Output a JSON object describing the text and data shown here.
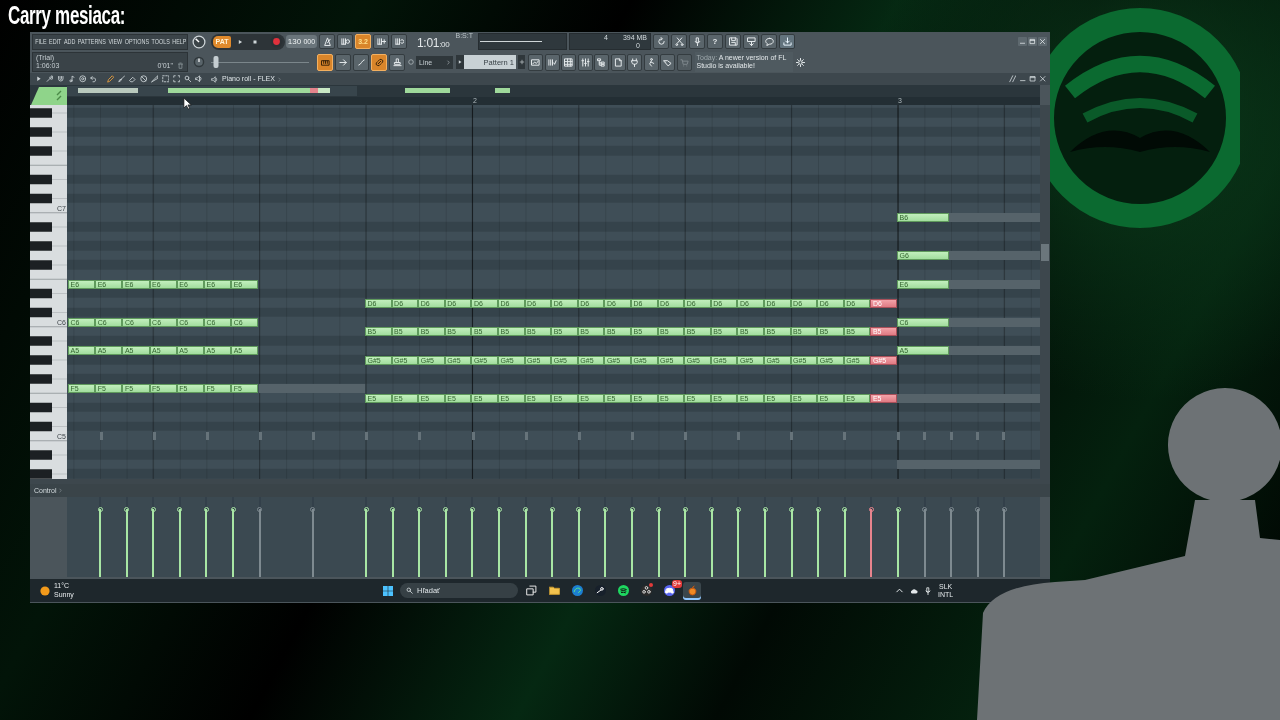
{
  "overlay": {
    "title": "Carry mesiaca:"
  },
  "menu": [
    "FILE",
    "EDIT",
    "ADD",
    "PATTERNS",
    "VIEW",
    "OPTIONS",
    "TOOLS",
    "HELP"
  ],
  "transport": {
    "mode": "PAT",
    "tempo": "130",
    "tempo_decimals": "000"
  },
  "top_toggles": [
    {
      "on": false
    },
    {
      "on": false
    },
    {
      "label": "3.2",
      "on": true
    },
    {
      "on": false
    },
    {
      "on": false
    }
  ],
  "song_position": {
    "value": "1:01",
    "ticks": ":00",
    "format": "B:S:T"
  },
  "cpu_panel": {
    "cpu": "4",
    "memory": "394 MB",
    "polyphony": "0"
  },
  "help_button": "?",
  "hint_panel": {
    "lines": [
      "(Trial)",
      "1:06:03"
    ],
    "value": "0'01\""
  },
  "pitch_slider": {
    "level": 0.05
  },
  "bottom_toggles": [
    {
      "on": true
    },
    {
      "on": false
    },
    {
      "on": false
    },
    {
      "on": true
    },
    {
      "on": false
    }
  ],
  "snap": "Line",
  "pattern": "Pattern 1",
  "news": {
    "date": "Today:",
    "text": "A newer version of FL Studio is available!"
  },
  "piano_roll": {
    "title": "Piano roll - FLEX",
    "tools": [
      {
        "selected": true
      },
      {
        "selected": false
      },
      {
        "selected": false
      },
      {
        "selected": false
      },
      {
        "selected": false
      },
      {
        "selected": false
      },
      {
        "selected": false
      },
      {
        "selected": false
      },
      {
        "selected": false
      }
    ],
    "keys": [
      "C7",
      "C6",
      "C5"
    ],
    "ruler": [
      "2",
      "3"
    ],
    "note_groups": [
      {
        "rows": [
          {
            "notes": [
              {
                "label": "E6",
                "selected": false
              },
              {
                "label": "E6",
                "selected": false
              },
              {
                "label": "E6",
                "selected": false
              },
              {
                "label": "E6",
                "selected": false
              },
              {
                "label": "E6",
                "selected": false
              },
              {
                "label": "E6",
                "selected": false
              },
              {
                "label": "E6",
                "selected": false
              }
            ]
          },
          {
            "notes": [
              {
                "label": "C6",
                "selected": false
              },
              {
                "label": "C6",
                "selected": false
              },
              {
                "label": "C6",
                "selected": false
              },
              {
                "label": "C6",
                "selected": false
              },
              {
                "label": "C6",
                "selected": false
              },
              {
                "label": "C6",
                "selected": false
              },
              {
                "label": "C6",
                "selected": false
              }
            ]
          },
          {
            "notes": [
              {
                "label": "A5",
                "selected": false
              },
              {
                "label": "A5",
                "selected": false
              },
              {
                "label": "A5",
                "selected": false
              },
              {
                "label": "A5",
                "selected": false
              },
              {
                "label": "A5",
                "selected": false
              },
              {
                "label": "A5",
                "selected": false
              },
              {
                "label": "A5",
                "selected": false
              }
            ]
          },
          {
            "notes": [
              {
                "label": "F5",
                "selected": false
              },
              {
                "label": "F5",
                "selected": false
              },
              {
                "label": "F5",
                "selected": false
              },
              {
                "label": "F5",
                "selected": false
              },
              {
                "label": "F5",
                "selected": false
              },
              {
                "label": "F5",
                "selected": false
              },
              {
                "label": "F5",
                "selected": false
              }
            ]
          }
        ]
      },
      {
        "rows": [
          {
            "notes": [
              {
                "label": "D6",
                "selected": false
              },
              {
                "label": "D6",
                "selected": false
              },
              {
                "label": "D6",
                "selected": false
              },
              {
                "label": "D6",
                "selected": false
              },
              {
                "label": "D6",
                "selected": false
              },
              {
                "label": "D6",
                "selected": false
              },
              {
                "label": "D6",
                "selected": false
              },
              {
                "label": "D6",
                "selected": false
              },
              {
                "label": "D6",
                "selected": false
              },
              {
                "label": "D6",
                "selected": false
              },
              {
                "label": "D6",
                "selected": false
              },
              {
                "label": "D6",
                "selected": false
              },
              {
                "label": "D6",
                "selected": false
              },
              {
                "label": "D6",
                "selected": false
              },
              {
                "label": "D6",
                "selected": false
              },
              {
                "label": "D6",
                "selected": false
              },
              {
                "label": "D6",
                "selected": false
              },
              {
                "label": "D6",
                "selected": false
              },
              {
                "label": "D6",
                "selected": false
              },
              {
                "label": "D6",
                "selected": true
              }
            ]
          },
          {
            "notes": [
              {
                "label": "B5",
                "selected": false
              },
              {
                "label": "B5",
                "selected": false
              },
              {
                "label": "B5",
                "selected": false
              },
              {
                "label": "B5",
                "selected": false
              },
              {
                "label": "B5",
                "selected": false
              },
              {
                "label": "B5",
                "selected": false
              },
              {
                "label": "B5",
                "selected": false
              },
              {
                "label": "B5",
                "selected": false
              },
              {
                "label": "B5",
                "selected": false
              },
              {
                "label": "B5",
                "selected": false
              },
              {
                "label": "B5",
                "selected": false
              },
              {
                "label": "B5",
                "selected": false
              },
              {
                "label": "B5",
                "selected": false
              },
              {
                "label": "B5",
                "selected": false
              },
              {
                "label": "B5",
                "selected": false
              },
              {
                "label": "B5",
                "selected": false
              },
              {
                "label": "B5",
                "selected": false
              },
              {
                "label": "B5",
                "selected": false
              },
              {
                "label": "B5",
                "selected": false
              },
              {
                "label": "B5",
                "selected": true
              }
            ]
          },
          {
            "notes": [
              {
                "label": "G#5",
                "selected": false
              },
              {
                "label": "G#5",
                "selected": false
              },
              {
                "label": "G#5",
                "selected": false
              },
              {
                "label": "G#5",
                "selected": false
              },
              {
                "label": "G#5",
                "selected": false
              },
              {
                "label": "G#5",
                "selected": false
              },
              {
                "label": "G#5",
                "selected": false
              },
              {
                "label": "G#5",
                "selected": false
              },
              {
                "label": "G#5",
                "selected": false
              },
              {
                "label": "G#5",
                "selected": false
              },
              {
                "label": "G#5",
                "selected": false
              },
              {
                "label": "G#5",
                "selected": false
              },
              {
                "label": "G#5",
                "selected": false
              },
              {
                "label": "G#5",
                "selected": false
              },
              {
                "label": "G#5",
                "selected": false
              },
              {
                "label": "G#5",
                "selected": false
              },
              {
                "label": "G#5",
                "selected": false
              },
              {
                "label": "G#5",
                "selected": false
              },
              {
                "label": "G#5",
                "selected": false
              },
              {
                "label": "G#5",
                "selected": true
              }
            ]
          },
          {
            "notes": [
              {
                "label": "E5",
                "selected": false
              },
              {
                "label": "E5",
                "selected": false
              },
              {
                "label": "E5",
                "selected": false
              },
              {
                "label": "E5",
                "selected": false
              },
              {
                "label": "E5",
                "selected": false
              },
              {
                "label": "E5",
                "selected": false
              },
              {
                "label": "E5",
                "selected": false
              },
              {
                "label": "E5",
                "selected": false
              },
              {
                "label": "E5",
                "selected": false
              },
              {
                "label": "E5",
                "selected": false
              },
              {
                "label": "E5",
                "selected": false
              },
              {
                "label": "E5",
                "selected": false
              },
              {
                "label": "E5",
                "selected": false
              },
              {
                "label": "E5",
                "selected": false
              },
              {
                "label": "E5",
                "selected": false
              },
              {
                "label": "E5",
                "selected": false
              },
              {
                "label": "E5",
                "selected": false
              },
              {
                "label": "E5",
                "selected": false
              },
              {
                "label": "E5",
                "selected": false
              },
              {
                "label": "E5",
                "selected": true
              }
            ]
          }
        ]
      },
      {
        "rows": [
          {
            "notes": [
              {
                "label": "B6",
                "selected": false
              }
            ]
          },
          {
            "notes": [
              {
                "label": "G6",
                "selected": false
              }
            ]
          },
          {
            "notes": [
              {
                "label": "E6",
                "selected": false
              }
            ]
          },
          {
            "notes": [
              {
                "label": "C6",
                "selected": false
              }
            ]
          },
          {
            "notes": [
              {
                "label": "A5",
                "selected": false
              }
            ]
          }
        ]
      }
    ],
    "control_label": "Control",
    "velocity": [
      {
        "kind": "note",
        "level": 0.85,
        "selected": false
      },
      {
        "kind": "note",
        "level": 0.85,
        "selected": false
      },
      {
        "kind": "note",
        "level": 0.85,
        "selected": false
      },
      {
        "kind": "note",
        "level": 0.85,
        "selected": false
      },
      {
        "kind": "note",
        "level": 0.85,
        "selected": false
      },
      {
        "kind": "note",
        "level": 0.85,
        "selected": false
      },
      {
        "kind": "ghost",
        "level": 0.85,
        "selected": false
      },
      {
        "kind": "gap"
      },
      {
        "kind": "ghost",
        "level": 0.85,
        "selected": false
      },
      {
        "kind": "gap"
      },
      {
        "kind": "note",
        "level": 0.85,
        "selected": false
      },
      {
        "kind": "note",
        "level": 0.85,
        "selected": false
      },
      {
        "kind": "note",
        "level": 0.85,
        "selected": false
      },
      {
        "kind": "note",
        "level": 0.85,
        "selected": false
      },
      {
        "kind": "note",
        "level": 0.85,
        "selected": false
      },
      {
        "kind": "note",
        "level": 0.85,
        "selected": false
      },
      {
        "kind": "note",
        "level": 0.85,
        "selected": false
      },
      {
        "kind": "note",
        "level": 0.85,
        "selected": false
      },
      {
        "kind": "note",
        "level": 0.85,
        "selected": false
      },
      {
        "kind": "note",
        "level": 0.85,
        "selected": false
      },
      {
        "kind": "note",
        "level": 0.85,
        "selected": false
      },
      {
        "kind": "note",
        "level": 0.85,
        "selected": false
      },
      {
        "kind": "note",
        "level": 0.85,
        "selected": false
      },
      {
        "kind": "note",
        "level": 0.85,
        "selected": false
      },
      {
        "kind": "note",
        "level": 0.85,
        "selected": false
      },
      {
        "kind": "note",
        "level": 0.85,
        "selected": false
      },
      {
        "kind": "note",
        "level": 0.85,
        "selected": false
      },
      {
        "kind": "note",
        "level": 0.85,
        "selected": false
      },
      {
        "kind": "note",
        "level": 0.85,
        "selected": false
      },
      {
        "kind": "note",
        "level": 0.85,
        "selected": true
      },
      {
        "kind": "note",
        "level": 0.85,
        "selected": false
      },
      {
        "kind": "ghost",
        "level": 0.85,
        "selected": false
      },
      {
        "kind": "ghost",
        "level": 0.85,
        "selected": false
      },
      {
        "kind": "ghost",
        "level": 0.85,
        "selected": false
      },
      {
        "kind": "ghost",
        "level": 0.85,
        "selected": false
      }
    ]
  },
  "taskbar": {
    "weather": {
      "temperature": "11°C",
      "condition": "Sunny"
    },
    "search": {
      "placeholder": "Hľadať"
    },
    "apps": [
      {
        "selected": false,
        "alert": false
      },
      {
        "selected": false,
        "alert": false
      },
      {
        "selected": false,
        "alert": false
      },
      {
        "selected": false,
        "alert": false
      },
      {
        "selected": false,
        "alert": false
      },
      {
        "selected": false,
        "alert": true
      },
      {
        "selected": false,
        "alert": false,
        "badge": "9+"
      },
      {
        "selected": true,
        "alert": false
      }
    ],
    "language": [
      "SLK",
      "INTL"
    ]
  }
}
